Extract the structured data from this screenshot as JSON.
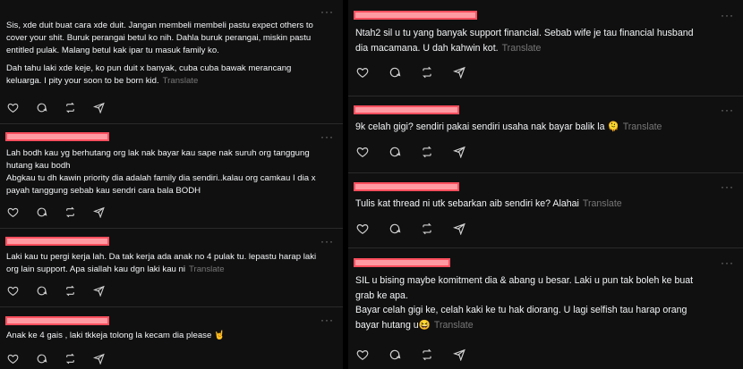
{
  "translate_label": "Translate",
  "more_label": "···",
  "left": [
    {
      "lines": [
        "Sis, xde duit buat cara xde duit. Jangan membeli membeli pastu expect others to",
        "cover your shit. Buruk perangai betul ko nih. Dahla buruk perangai, miskin pastu",
        "entitled pulak. Malang betul kak ipar tu masuk family ko."
      ],
      "lines2": [
        "Dah tahu laki xde keje, ko pun duit x banyak, cuba cuba bawak merancang",
        "keluarga. I pity your soon to be born kid."
      ]
    },
    {
      "lines": [
        "Lah bodh kau yg berhutang org lak nak bayar kau sape nak suruh org tanggung",
        "hutang kau bodh",
        "Abgkau tu dh kawin priority dia adalah family dia sendiri..kalau org camkau I dia x",
        "payah tanggung sebab kau sendri cara bala BODH"
      ]
    },
    {
      "lines": [
        "Laki kau tu pergi kerja lah. Da tak kerja ada anak no 4 pulak tu. lepastu harap laki",
        "org lain support. Apa siallah kau dgn laki kau ni"
      ]
    },
    {
      "lines": [
        "Anak ke 4 gais , laki tkkeja tolong la kecam dia please 🤘"
      ]
    }
  ],
  "right": [
    {
      "lines": [
        "Ntah2 sil u tu yang banyak support financial. Sebab wife je tau financial husband",
        "dia macamana. U dah kahwin kot."
      ]
    },
    {
      "lines": [
        "9k celah gigi? sendiri pakai sendiri usaha nak bayar balik la 🫠"
      ]
    },
    {
      "lines": [
        "Tulis kat thread ni utk sebarkan aib sendiri ke? Alahai"
      ]
    },
    {
      "lines": [
        "SIL u bising maybe komitment dia & abang u besar. Laki u pun tak boleh ke buat",
        "grab ke apa.",
        "Bayar celah gigi ke, celah kaki ke tu hak diorang. U lagi selfish tau harap orang",
        "bayar hutang u😆"
      ]
    }
  ],
  "icons": [
    "heart-icon",
    "comment-icon",
    "repost-icon",
    "share-icon"
  ],
  "colors": {
    "background": "#101010",
    "text": "#f3f5f7",
    "muted": "#777777",
    "redaction": "#ff9aa2"
  }
}
